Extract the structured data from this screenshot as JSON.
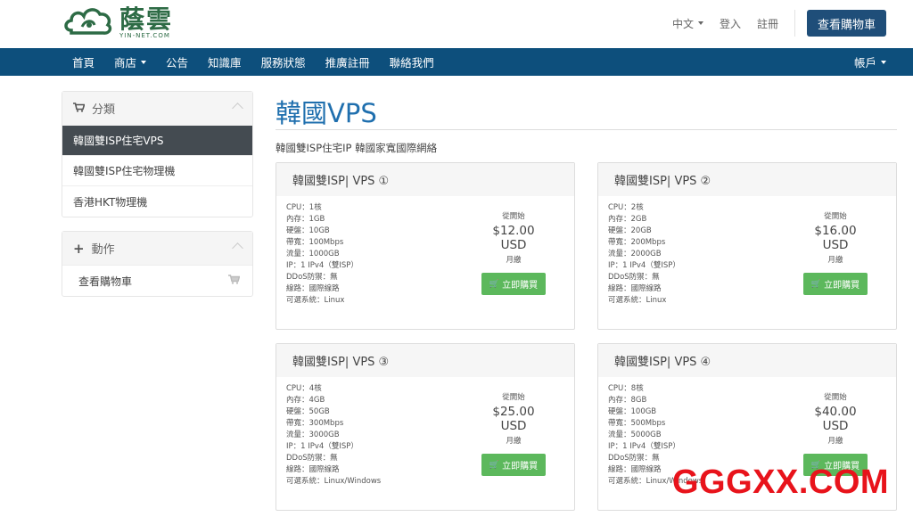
{
  "brand": {
    "name": "蔭雲",
    "domain": "YIN-NET.COM",
    "color": "#2d6b45"
  },
  "header": {
    "language": "中文",
    "login": "登入",
    "register": "註冊",
    "cart_button": "查看購物車",
    "cart_color": "#1f4e79"
  },
  "nav": {
    "items": [
      "首頁",
      "商店",
      "公告",
      "知識庫",
      "服務狀態",
      "推廣註冊",
      "聯絡我們"
    ],
    "account": "帳戶",
    "color": "#0d4f7c"
  },
  "sidebar": {
    "categories_title": "分類",
    "categories": [
      {
        "label": "韓國雙ISP住宅VPS",
        "active": true
      },
      {
        "label": "韓國雙ISP住宅物理機",
        "active": false
      },
      {
        "label": "香港HKT物理機",
        "active": false
      }
    ],
    "actions_title": "動作",
    "actions": [
      {
        "label": "查看購物車"
      }
    ]
  },
  "main": {
    "title": "韓國VPS",
    "subtitle": "韓國雙ISP住宅IP 韓國家寬國際網絡",
    "title_color": "#1f6fae"
  },
  "products": [
    {
      "name": "韓國雙ISP| VPS ①",
      "specs": [
        "CPU：1核",
        "內存：1GB",
        "硬盤：10GB",
        "帶寬：100Mbps",
        "流量：1000GB",
        "IP：1 IPv4（雙ISP）",
        "DDoS防禦：無",
        "線路：國際線路",
        "可選系統：Linux"
      ],
      "from": "從開始",
      "price": "$12.00 USD",
      "period": "月繳",
      "buy": "立即購買"
    },
    {
      "name": "韓國雙ISP| VPS ②",
      "specs": [
        "CPU：2核",
        "內存：2GB",
        "硬盤：20GB",
        "帶寬：200Mbps",
        "流量：2000GB",
        "IP：1 IPv4（雙ISP）",
        "DDoS防禦：無",
        "線路：國際線路",
        "可選系統：Linux"
      ],
      "from": "從開始",
      "price": "$16.00 USD",
      "period": "月繳",
      "buy": "立即購買"
    },
    {
      "name": "韓國雙ISP| VPS ③",
      "specs": [
        "CPU：4核",
        "內存：4GB",
        "硬盤：50GB",
        "帶寬：300Mbps",
        "流量：3000GB",
        "IP：1 IPv4（雙ISP）",
        "DDoS防禦：無",
        "線路：國際線路",
        "可選系統：Linux/Windows"
      ],
      "from": "從開始",
      "price": "$25.00 USD",
      "period": "月繳",
      "buy": "立即購買"
    },
    {
      "name": "韓國雙ISP| VPS ④",
      "specs": [
        "CPU：8核",
        "內存：8GB",
        "硬盤：100GB",
        "帶寬：500Mbps",
        "流量：5000GB",
        "IP：1 IPv4（雙ISP）",
        "DDoS防禦：無",
        "線路：國際線路",
        "可選系統：Linux/Windows"
      ],
      "from": "從開始",
      "price": "$40.00 USD",
      "period": "月繳",
      "buy": "立即購買"
    }
  ],
  "watermark": {
    "text": "GGGXX.COM",
    "color": "#e8131b"
  },
  "buy_color": "#5cb85c"
}
